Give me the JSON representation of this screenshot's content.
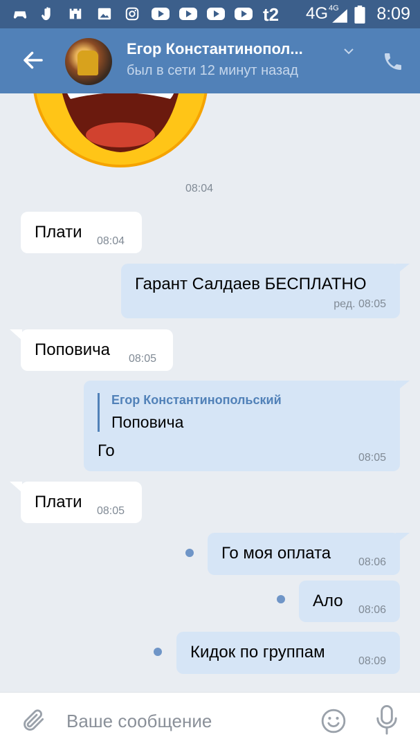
{
  "status_bar": {
    "carrier": "t2",
    "network": "4G",
    "network_small": "4G",
    "time": "8:09"
  },
  "header": {
    "name": "Егор Константинопол...",
    "status": "был в сети 12 минут назад"
  },
  "messages": [
    {
      "dir": "in",
      "text": "Плати",
      "time": "08:04"
    },
    {
      "dir": "out",
      "text": "Гарант Салдаев БЕСПЛАТНО",
      "time": "ред. 08:05"
    },
    {
      "dir": "in",
      "text": "Поповича",
      "time": "08:05"
    },
    {
      "dir": "out",
      "reply_author": "Егор Константинопольский",
      "reply_text": "Поповича",
      "text": "Го",
      "time": "08:05"
    },
    {
      "dir": "in",
      "text": "Плати",
      "time": "08:05"
    },
    {
      "dir": "out",
      "text": "Го моя оплата",
      "time": "08:06",
      "unread": true
    },
    {
      "dir": "out",
      "text": "Ало",
      "time": "08:06",
      "unread": true
    },
    {
      "dir": "out",
      "text": "Кидок по группам",
      "time": "08:09",
      "unread": true
    }
  ],
  "sticker": {
    "time": "08:04",
    "icon": "laughing-crying-emoji"
  },
  "composer": {
    "placeholder": "Ваше сообщение"
  },
  "colors": {
    "header": "#5181b8",
    "status_bar": "#3c5f8b",
    "bubble_out": "#d6e5f6",
    "bubble_in": "#ffffff",
    "background": "#e9edf2"
  }
}
